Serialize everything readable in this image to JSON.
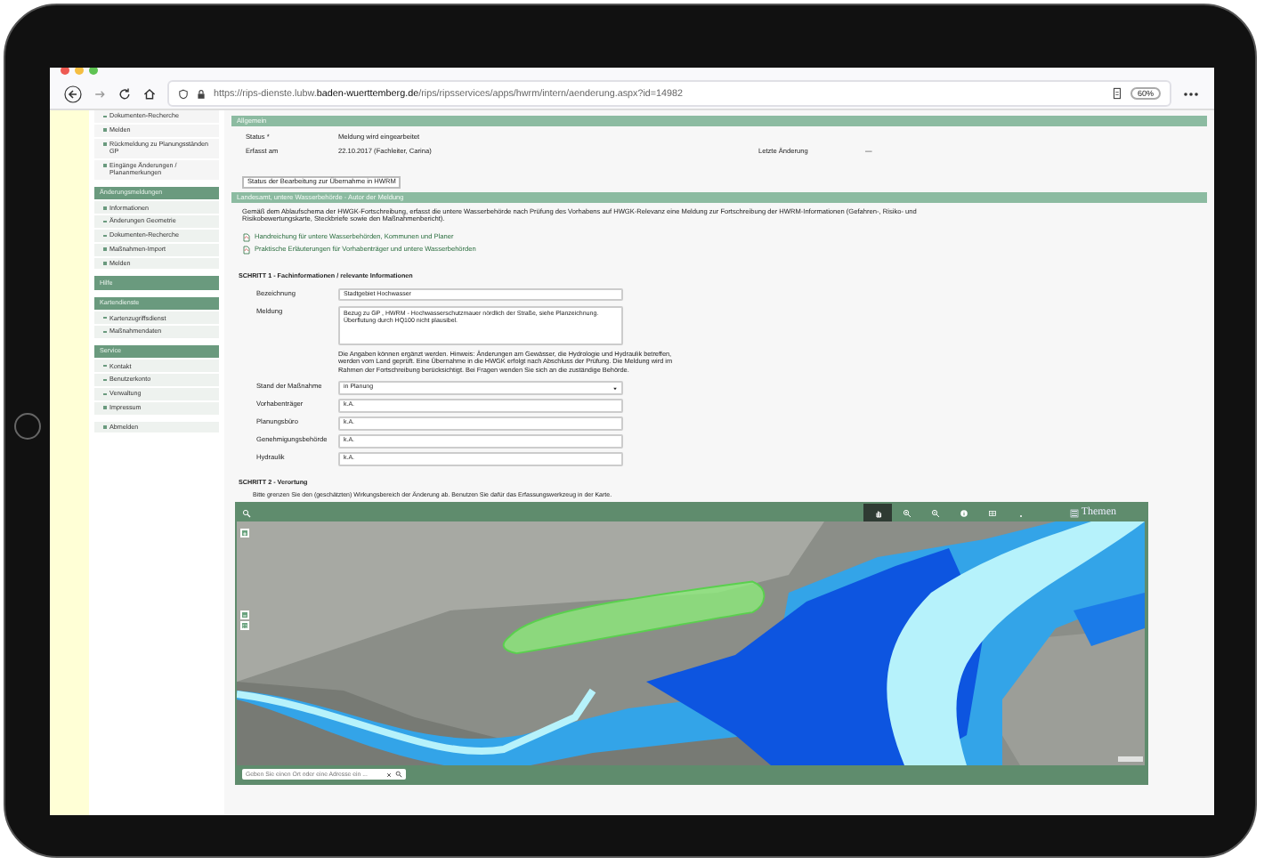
{
  "browser": {
    "address": "https://rips-dienste.lubw.**baden-wuerttemberg.de**/rips/ripsservices/apps/hwrm/intern/aenderung.aspx?id=14982",
    "zoom": "60%"
  },
  "sidebar": {
    "groups": [
      {
        "items": [
          "Dokumenten-Recherche",
          "Melden",
          "Rückmeldung zu Planungsständen GP",
          "Eingänge Änderungen / Plananmerkungen"
        ]
      },
      {
        "title": "Änderungsmeldungen",
        "items": [
          "Informationen",
          "Änderungen Geometrie",
          "Dokumenten-Recherche",
          "Maßnahmen-Import",
          "Melden"
        ]
      },
      {
        "title": "Hilfe"
      },
      {
        "title": "Kartendienste",
        "items": [
          "Kartenzugriffsdienst",
          "Maßnahmendaten"
        ]
      },
      {
        "title": "Service",
        "items": [
          "Kontakt",
          "Benutzerkonto",
          "Verwaltung",
          "Impressum"
        ]
      },
      {
        "items": [
          "Abmelden"
        ]
      }
    ]
  },
  "general": {
    "title": "Allgemein",
    "rows": [
      {
        "label": "Status *",
        "value": "Meldung wird eingearbeitet"
      },
      {
        "label": "Erfasst am",
        "value": "22.10.2017 (Fachleiter, Carina)"
      }
    ],
    "last_change": {
      "label": "Letzte Änderung",
      "value": "—"
    },
    "note": "Status der Bearbeitung zur Übernahme in HWRM"
  },
  "author": {
    "title": "Landesamt, untere Wasserbehörde - Autor der Meldung",
    "text": "Gemäß dem Ablaufschema der HWGK-Fortschreibung, erfasst die untere Wasserbehörde nach Prüfung des Vorhabens auf HWGK-Relevanz eine Meldung zur Fortschreibung der HWRM-Informationen (Gefahren-, Risiko- und Risikobewertungskarte, Steckbriefe sowie den Maßnahmenbericht).",
    "links": [
      "Handreichung für untere Wasserbehörden, Kommunen und Planer",
      "Praktische Erläuterungen für Vorhabenträger und untere Wasserbehörden"
    ]
  },
  "step1": {
    "title": "SCHRITT 1 - Fachinformationen / relevante Informationen",
    "fields": [
      {
        "kind": "text",
        "label": "Bezeichnung",
        "value": "Stadtgebiet Hochwasser"
      },
      {
        "kind": "textarea",
        "label": "Meldung",
        "value": "Bezug zu GP      , HWRM - Hochwasserschutzmauer nördlich der Straße, siehe Planzeichnung. Überflutung durch HQ100 nicht plausibel.",
        "hint": "Die Angaben können ergänzt werden. Hinweis: Änderungen am Gewässer, die Hydrologie und Hydraulik betreffen, werden vom Land geprüft. Eine Übernahme in die HWGK erfolgt nach Abschluss der Prüfung. Die Meldung wird im Rahmen der Fortschreibung berücksichtigt. Bei Fragen wenden Sie sich an die zuständige Behörde."
      },
      {
        "kind": "select",
        "label": "Stand der Maßnahme",
        "value": "in Planung"
      },
      {
        "kind": "text",
        "label": "Vorhabenträger",
        "value": "k.A."
      },
      {
        "kind": "text",
        "label": "Planungsbüro",
        "value": "k.A."
      },
      {
        "kind": "text",
        "label": "Genehmigungsbehörde",
        "value": "k.A."
      },
      {
        "kind": "text",
        "label": "Hydraulik",
        "value": "k.A."
      }
    ]
  },
  "step2": {
    "title": "SCHRITT 2 - Verortung",
    "text": "Bitte grenzen Sie den (geschätzten) Wirkungsbereich der Änderung ab. Benutzen Sie dafür das Erfassungswerkzeug in der Karte.",
    "map": {
      "themes": "Themen",
      "search_placeholder": "Geben Sie einen Ort oder eine Adresse ein ..."
    }
  }
}
